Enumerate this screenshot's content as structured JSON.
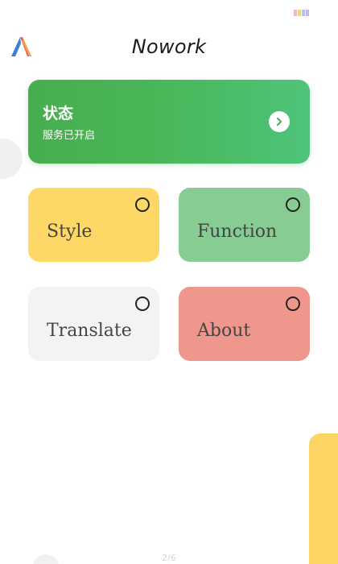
{
  "header": {
    "title": "Nowork",
    "logo_icon": "nowork-logo-icon"
  },
  "status_card": {
    "title": "状态",
    "subtitle": "服务已开启",
    "arrow_icon": "chevron-right-icon",
    "color": "#4ab35a"
  },
  "tiles": [
    {
      "label": "Style",
      "color": "#fed866"
    },
    {
      "label": "Function",
      "color": "#87cc93"
    },
    {
      "label": "Translate",
      "color": "#f4f2f5"
    },
    {
      "label": "About",
      "color": "#ef968d"
    }
  ],
  "footer": {
    "page_indicator": "2/6"
  }
}
